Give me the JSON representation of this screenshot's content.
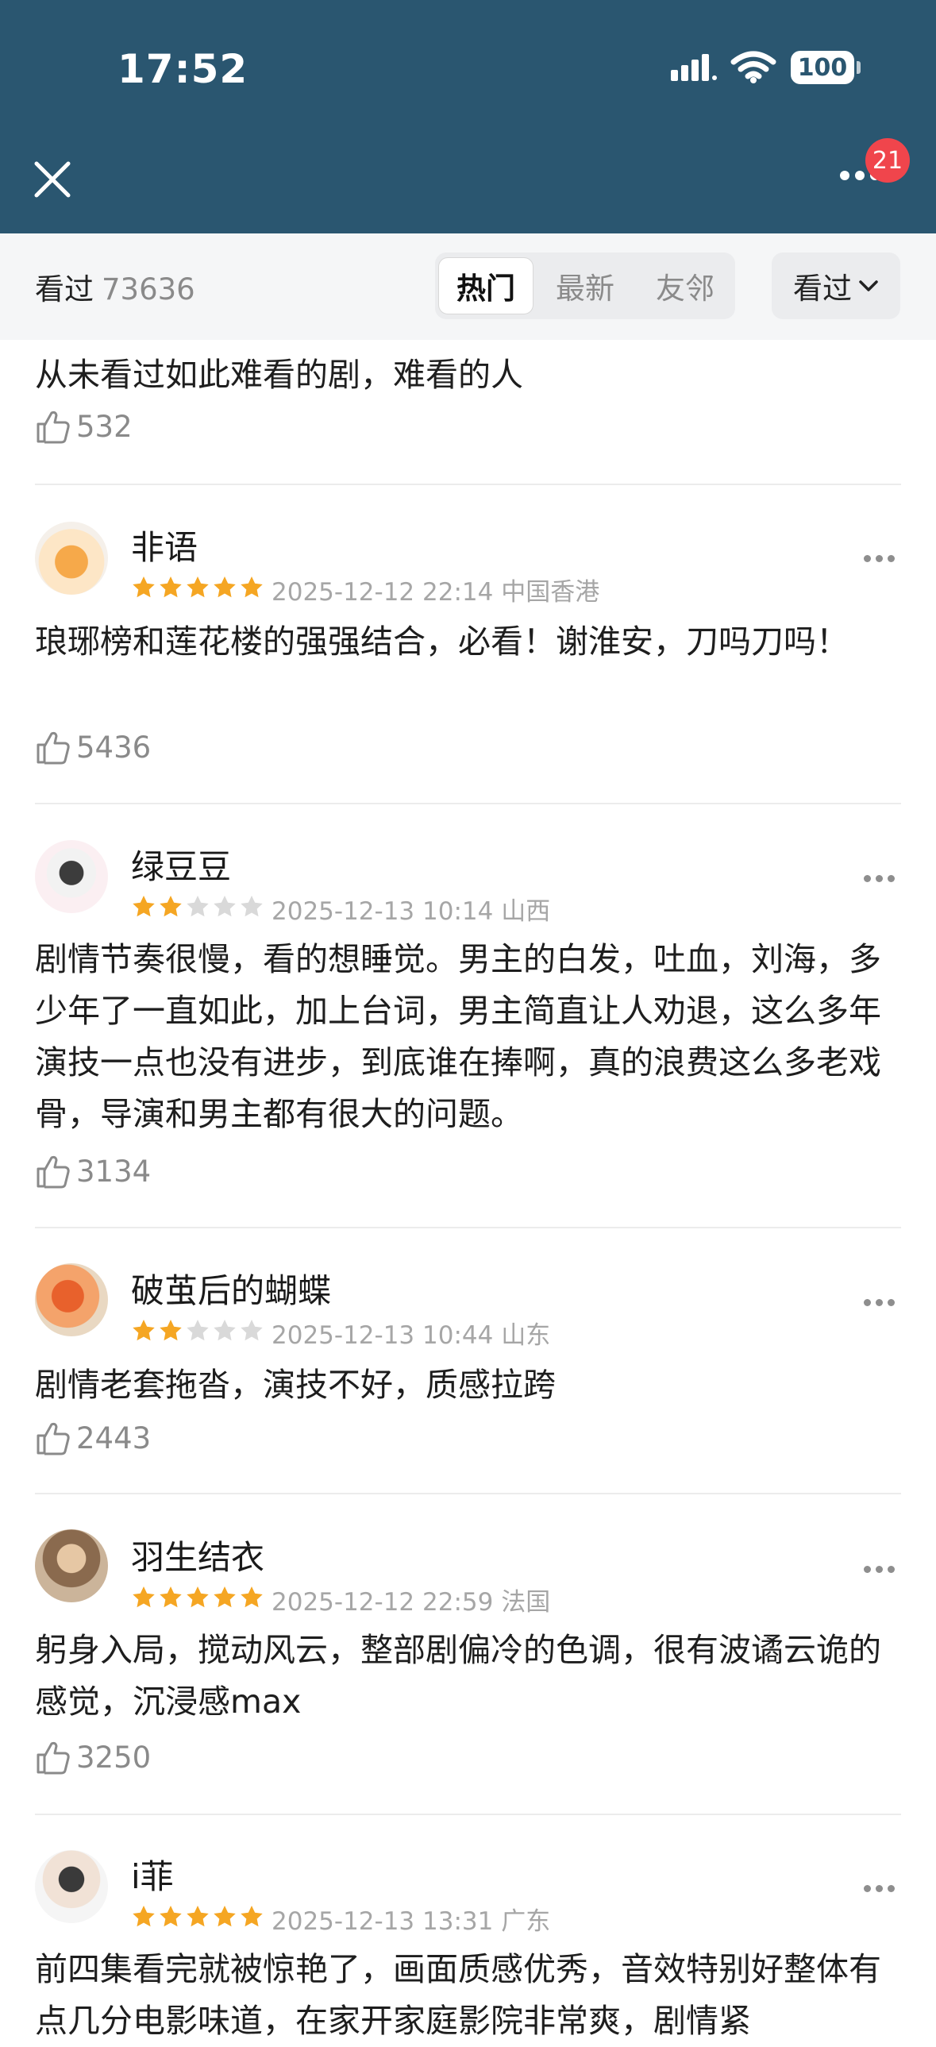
{
  "status_bar": {
    "time": "17:52",
    "battery": "100"
  },
  "nav": {
    "badge": "21"
  },
  "filter": {
    "seen_label": "看过",
    "seen_count": "73636",
    "tabs": [
      "热门",
      "最新",
      "友邻"
    ],
    "dropdown_label": "看过"
  },
  "first_comment": {
    "text": "从未看过如此难看的剧，难看的人",
    "likes": "532"
  },
  "comments": [
    {
      "name": "非语",
      "rating": 5,
      "datetime": "2025-12-12 22:14",
      "location": "中国香港",
      "text": "琅琊榜和莲花楼的强强结合，必看！谢淮安，刀吗刀吗！",
      "likes": "5436"
    },
    {
      "name": "绿豆豆",
      "rating": 2,
      "datetime": "2025-12-13 10:14",
      "location": "山西",
      "text": "剧情节奏很慢，看的想睡觉。男主的白发，吐血，刘海，多少年了一直如此，加上台词，男主简直让人劝退，这么多年演技一点也没有进步，到底谁在捧啊，真的浪费这么多老戏骨，导演和男主都有很大的问题。",
      "likes": "3134"
    },
    {
      "name": "破茧后的蝴蝶",
      "rating": 2,
      "datetime": "2025-12-13 10:44",
      "location": "山东",
      "text": "剧情老套拖沓，演技不好，质感拉跨",
      "likes": "2443"
    },
    {
      "name": "羽生结衣",
      "rating": 5,
      "datetime": "2025-12-12 22:59",
      "location": "法国",
      "text": "躬身入局，搅动风云，整部剧偏冷的色调，很有波谲云诡的感觉，沉浸感max",
      "likes": "3250"
    },
    {
      "name": "i菲",
      "rating": 5,
      "datetime": "2025-12-13 13:31",
      "location": "广东",
      "text": "前四集看完就被惊艳了，画面质感优秀，音效特别好整体有点几分电影味道，在家开家庭影院非常爽，剧情紧",
      "likes": ""
    }
  ],
  "colors": {
    "header": "#2a5670",
    "star": "#f5a623",
    "star_empty": "#d9d9d9",
    "badge": "#f0454c"
  }
}
